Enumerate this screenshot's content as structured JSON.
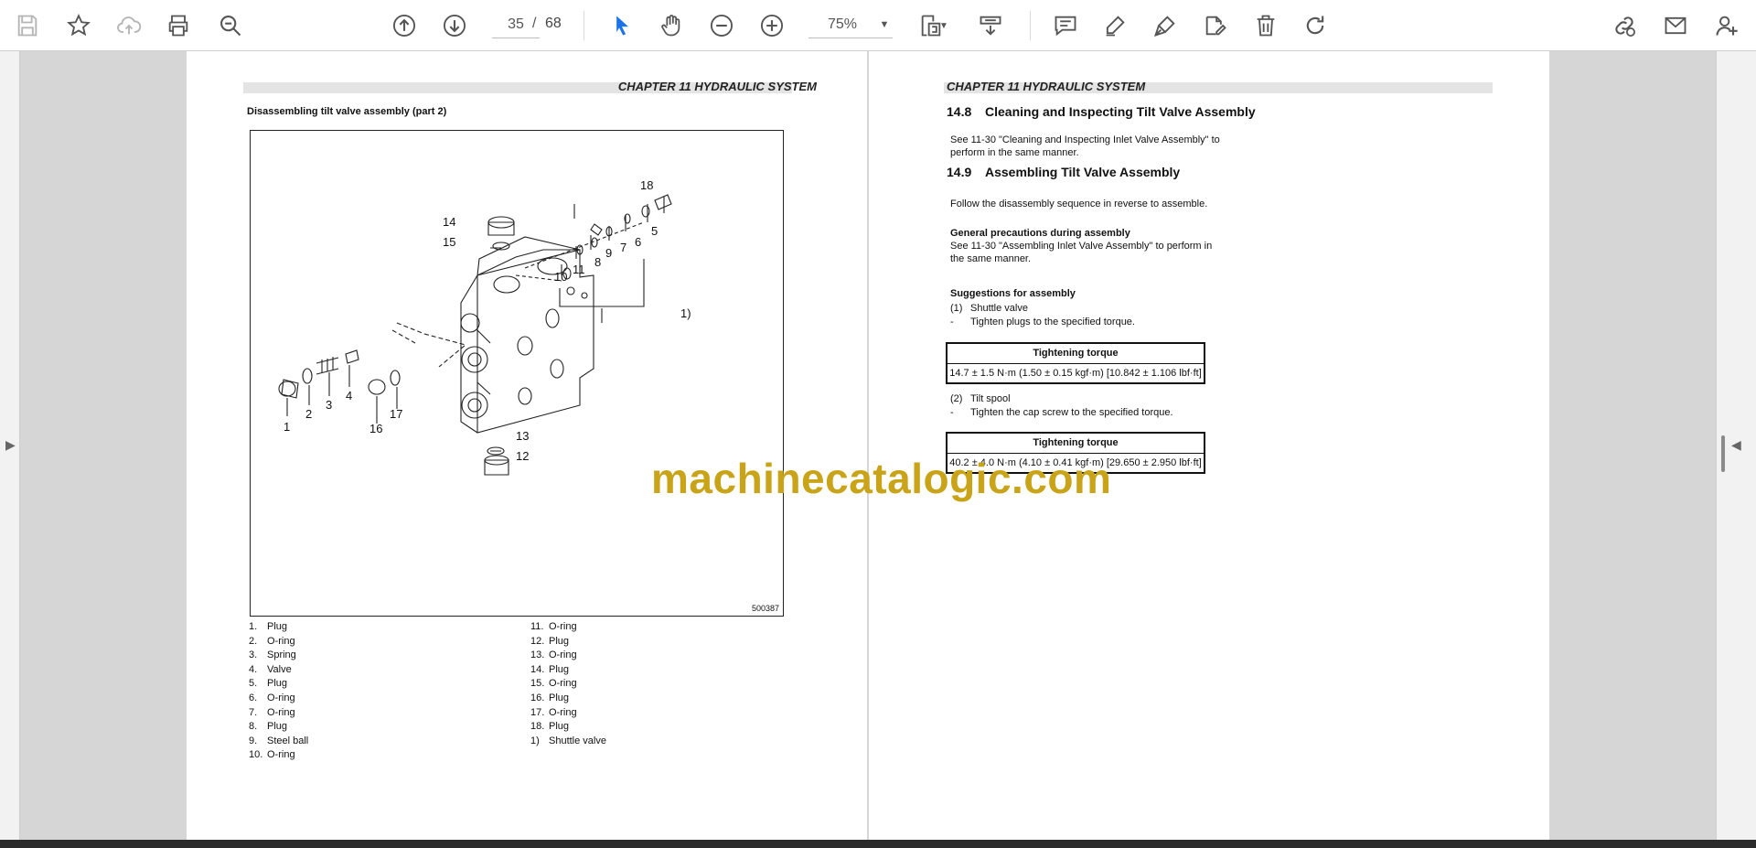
{
  "toolbar": {
    "page_current": "35",
    "page_separator": "/",
    "page_total": "68",
    "zoom": "75%"
  },
  "icons": [
    "save-icon",
    "bookmark-star-icon",
    "cloud-upload-icon",
    "print-icon",
    "zoom-out-search-icon",
    "page-up-icon",
    "page-down-icon",
    "select-cursor-icon",
    "hand-tool-icon",
    "zoom-minus-icon",
    "zoom-plus-icon",
    "fit-page-icon",
    "scroll-mode-icon",
    "comment-icon",
    "highlight-pen-icon",
    "draw-pen-icon",
    "edit-sign-icon",
    "delete-icon",
    "rotate-icon",
    "share-link-icon",
    "mail-icon",
    "add-user-icon"
  ],
  "left_page": {
    "chapter": "CHAPTER 11 HYDRAULIC SYSTEM",
    "figure_title": "Disassembling tilt valve assembly (part 2)",
    "figure_code": "500387",
    "callouts": [
      "1",
      "2",
      "3",
      "4",
      "5",
      "6",
      "7",
      "8",
      "9",
      "10",
      "11",
      "12",
      "13",
      "14",
      "15",
      "16",
      "17",
      "18",
      "1)"
    ],
    "legend_col1": [
      {
        "num": "1.",
        "label": "Plug"
      },
      {
        "num": "2.",
        "label": "O-ring"
      },
      {
        "num": "3.",
        "label": "Spring"
      },
      {
        "num": "4.",
        "label": "Valve"
      },
      {
        "num": "5.",
        "label": "Plug"
      },
      {
        "num": "6.",
        "label": "O-ring"
      },
      {
        "num": "7.",
        "label": "O-ring"
      },
      {
        "num": "8.",
        "label": "Plug"
      },
      {
        "num": "9.",
        "label": "Steel ball"
      },
      {
        "num": "10.",
        "label": "O-ring"
      }
    ],
    "legend_col2": [
      {
        "num": "11.",
        "label": "O-ring"
      },
      {
        "num": "12.",
        "label": "Plug"
      },
      {
        "num": "13.",
        "label": "O-ring"
      },
      {
        "num": "14.",
        "label": "Plug"
      },
      {
        "num": "15.",
        "label": "O-ring"
      },
      {
        "num": "16.",
        "label": "Plug"
      },
      {
        "num": "17.",
        "label": "O-ring"
      },
      {
        "num": "18.",
        "label": "Plug"
      },
      {
        "num": "1)",
        "label": "Shuttle valve"
      }
    ]
  },
  "right_page": {
    "chapter": "CHAPTER 11 HYDRAULIC SYSTEM",
    "sec1_num": "14.8",
    "sec1_title": "Cleaning and Inspecting Tilt Valve Assembly",
    "sec1_text_1": "See 11-30 \"Cleaning and Inspecting Inlet Valve Assembly\" to",
    "sec1_text_2": "perform in the same manner.",
    "sec2_num": "14.9",
    "sec2_title": "Assembling Tilt Valve Assembly",
    "sec2_text": "Follow the disassembly sequence in reverse to assemble.",
    "precautions_title": "General precautions during assembly",
    "precautions_text_1": "See 11-30 \"Assembling Inlet Valve Assembly\" to perform in",
    "precautions_text_2": "the same manner.",
    "suggestions_title": "Suggestions for assembly",
    "item1_num": "(1)",
    "item1_title": "Shuttle valve",
    "item1_dash": "-",
    "item1_text": "Tighten plugs to the specified torque.",
    "table_header": "Tightening torque",
    "table1_value": "14.7 ± 1.5 N·m (1.50 ± 0.15 kgf·m) [10.842 ± 1.106 lbf·ft]",
    "item2_num": "(2)",
    "item2_title": "Tilt spool",
    "item2_dash": "-",
    "item2_text": "Tighten the cap screw to the specified torque.",
    "table2_value": "40.2 ± 4.0 N·m (4.10 ± 0.41 kgf·m) [29.650 ± 2.950 lbf·ft]"
  },
  "watermark": "machinecatalogic.com",
  "colors": {
    "accent_blue": "#1a73e8",
    "watermark": "#c9a418",
    "icon_gray": "#555555"
  }
}
